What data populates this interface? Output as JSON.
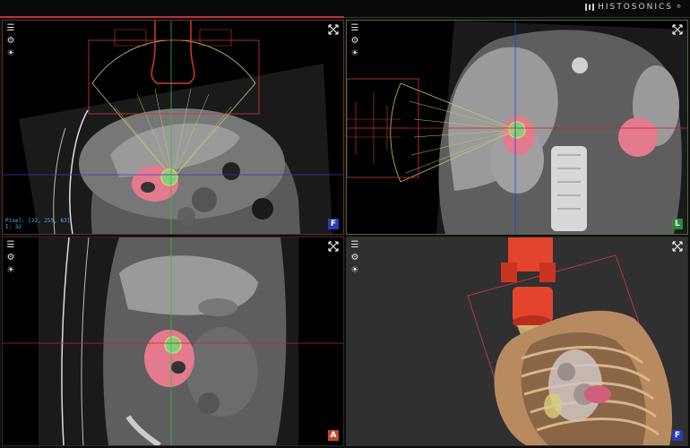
{
  "app": {
    "brand": "HISTOSONICS",
    "brand_mark": "®"
  },
  "colors": {
    "tissue": "#8a8a8a",
    "target_tumor": "#e37a8e",
    "treatment_zone": "#d6d07a",
    "device_outline": "#d23a2e",
    "axis_green": "#2fbf3a",
    "axis_red": "#c8222a",
    "axis_blue": "#2b3fcf",
    "readout": "#4fb3e8"
  },
  "viewports": {
    "top_left": {
      "orientation_label": "F",
      "orientation_color": "#2a3bb8",
      "readout_line1": "Pixel: [22, 255, 63]",
      "readout_line2": "I: 32",
      "icons": [
        "menu-icon",
        "gear-icon",
        "brightness-icon",
        "maximize-icon"
      ]
    },
    "top_right": {
      "orientation_label": "L",
      "orientation_color": "#2f8a3a",
      "icons": [
        "menu-icon",
        "gear-icon",
        "brightness-icon",
        "maximize-icon"
      ]
    },
    "bottom_left": {
      "orientation_label": "A",
      "orientation_color": "#c0462a",
      "icons": [
        "menu-icon",
        "gear-icon",
        "brightness-icon",
        "maximize-icon"
      ]
    },
    "bottom_right": {
      "orientation_label": "F",
      "orientation_color": "#2a3bb8",
      "icons": [
        "menu-icon",
        "gear-icon",
        "brightness-icon",
        "maximize-icon"
      ]
    }
  }
}
